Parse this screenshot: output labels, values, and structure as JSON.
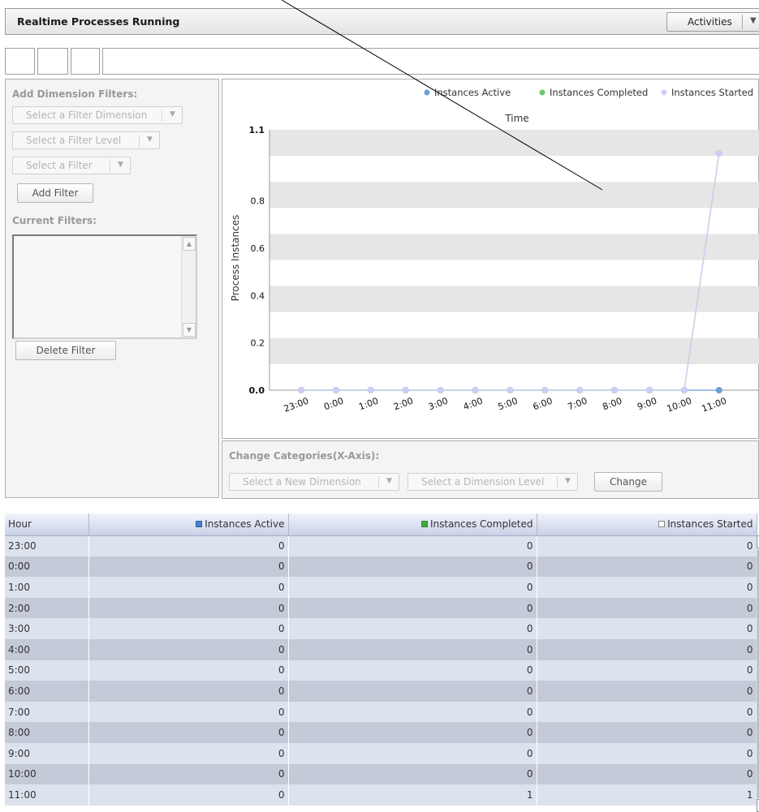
{
  "header": {
    "title": "Realtime Processes Running",
    "activities_label": "Activities"
  },
  "filters": {
    "add_title": "Add Dimension Filters:",
    "select_dimension": "Select a Filter Dimension",
    "select_level": "Select a Filter Level",
    "select_filter": "Select a Filter",
    "add_filter": "Add Filter",
    "current_title": "Current Filters:",
    "delete_filter": "Delete Filter"
  },
  "chart_data": {
    "type": "line",
    "title": "Time",
    "ylabel": "Process Instances",
    "xlabel": "",
    "categories": [
      "23:00",
      "0:00",
      "1:00",
      "2:00",
      "3:00",
      "4:00",
      "5:00",
      "6:00",
      "7:00",
      "8:00",
      "9:00",
      "10:00",
      "11:00"
    ],
    "series": [
      {
        "name": "Instances Active",
        "color": "#6e9fd8",
        "values": [
          0,
          0,
          0,
          0,
          0,
          0,
          0,
          0,
          0,
          0,
          0,
          0,
          0
        ]
      },
      {
        "name": "Instances Completed",
        "color": "#6cc56c",
        "values": [
          0,
          0,
          0,
          0,
          0,
          0,
          0,
          0,
          0,
          0,
          0,
          0,
          1
        ]
      },
      {
        "name": "Instances Started",
        "color": "#cdcdf7",
        "values": [
          0,
          0,
          0,
          0,
          0,
          0,
          0,
          0,
          0,
          0,
          0,
          0,
          1
        ]
      }
    ],
    "ylim": [
      0,
      1.1
    ],
    "yticks": [
      "1.1",
      "0.8",
      "0.6",
      "0.4",
      "0.2",
      "0.0"
    ],
    "legend_position": "top-right",
    "grid": true
  },
  "categories_panel": {
    "title": "Change Categories(X-Axis):",
    "select_dimension": "Select a New Dimension",
    "select_level": "Select a Dimension Level",
    "change": "Change"
  },
  "table": {
    "headers": [
      "Hour",
      "Instances Active",
      "Instances Completed",
      "Instances Started"
    ],
    "header_colors": [
      "",
      "#4a80d0",
      "#3fae3f",
      "#ffffff"
    ],
    "rows": [
      [
        "23:00",
        "0",
        "0",
        "0"
      ],
      [
        "0:00",
        "0",
        "0",
        "0"
      ],
      [
        "1:00",
        "0",
        "0",
        "0"
      ],
      [
        "2:00",
        "0",
        "0",
        "0"
      ],
      [
        "3:00",
        "0",
        "0",
        "0"
      ],
      [
        "4:00",
        "0",
        "0",
        "0"
      ],
      [
        "5:00",
        "0",
        "0",
        "0"
      ],
      [
        "6:00",
        "0",
        "0",
        "0"
      ],
      [
        "7:00",
        "0",
        "0",
        "0"
      ],
      [
        "8:00",
        "0",
        "0",
        "0"
      ],
      [
        "9:00",
        "0",
        "0",
        "0"
      ],
      [
        "10:00",
        "0",
        "0",
        "0"
      ],
      [
        "11:00",
        "0",
        "1",
        "1"
      ]
    ]
  }
}
